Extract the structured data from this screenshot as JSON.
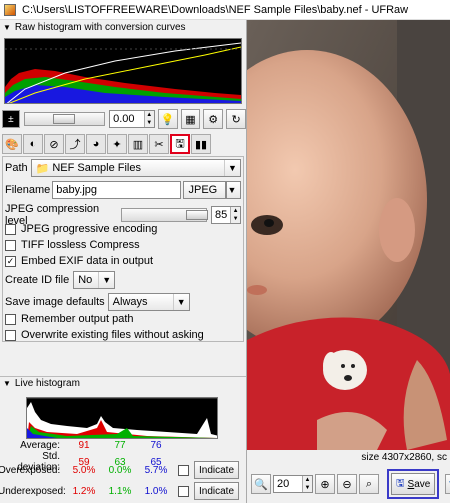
{
  "window": {
    "title": "C:\\Users\\LISTOFFREEWARE\\Downloads\\NEF Sample Files\\baby.nef - UFRaw"
  },
  "raw_histogram": {
    "header": "Raw histogram with conversion curves"
  },
  "exposure": {
    "value": "0.00"
  },
  "save_panel": {
    "path_label": "Path",
    "path_value": "NEF Sample Files",
    "filename_label": "Filename",
    "filename_value": "baby.jpg",
    "format_value": "JPEG",
    "compression_label": "JPEG compression level",
    "compression_value": "85",
    "progressive_label": "JPEG progressive encoding",
    "progressive_checked": false,
    "tiff_label": "TIFF lossless Compress",
    "tiff_checked": false,
    "exif_label": "Embed EXIF data in output",
    "exif_checked": true,
    "create_id_label": "Create ID file",
    "create_id_value": "No",
    "save_defaults_label": "Save image defaults",
    "save_defaults_value": "Always",
    "remember_path_label": "Remember output path",
    "remember_path_checked": false,
    "overwrite_label": "Overwrite existing files without asking",
    "overwrite_checked": false
  },
  "live_histogram": {
    "header": "Live histogram",
    "average_label": "Average:",
    "average_r": "91",
    "average_g": "77",
    "average_b": "76",
    "std_label": "Std. deviation:",
    "std_r": "59",
    "std_g": "63",
    "std_b": "65",
    "over_label": "Overexposed:",
    "over_r": "5.0%",
    "over_g": "0.0%",
    "over_b": "5.7%",
    "under_label": "Underexposed:",
    "under_r": "1.2%",
    "under_g": "1.1%",
    "under_b": "1.0%",
    "indicate_label": "Indicate"
  },
  "preview": {
    "size_text": "size 4307x2860, sc",
    "zoom_value": "20"
  },
  "save_button": {
    "label_u": "S",
    "label_rest": "ave"
  },
  "colors": {
    "red": "#e00000",
    "green": "#00b000",
    "blue": "#1010d0",
    "highlight_red": "#e0001b",
    "highlight_blue": "#3a3ac8"
  }
}
